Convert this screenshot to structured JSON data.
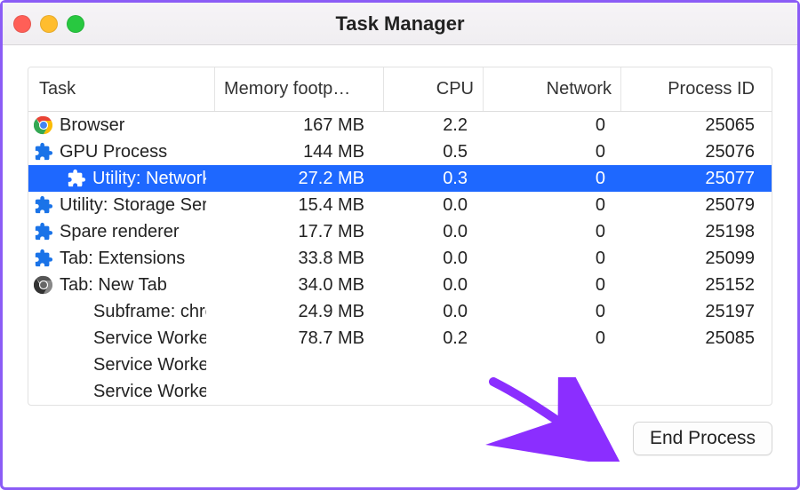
{
  "window": {
    "title": "Task Manager"
  },
  "columns": {
    "task": "Task",
    "memory": "Memory footp…",
    "cpu": "CPU",
    "network": "Network",
    "pid": "Process ID"
  },
  "rows": [
    {
      "icon": "chrome",
      "indent": false,
      "task": "Browser",
      "memory": "167 MB",
      "cpu": "2.2",
      "network": "0",
      "pid": "25065",
      "selected": false
    },
    {
      "icon": "ext",
      "indent": false,
      "task": "GPU Process",
      "memory": "144 MB",
      "cpu": "0.5",
      "network": "0",
      "pid": "25076",
      "selected": false
    },
    {
      "icon": "ext",
      "indent": true,
      "task": "Utility: Network Se",
      "memory": "27.2 MB",
      "cpu": "0.3",
      "network": "0",
      "pid": "25077",
      "selected": true
    },
    {
      "icon": "ext",
      "indent": false,
      "task": "Utility: Storage Ser",
      "memory": "15.4 MB",
      "cpu": "0.0",
      "network": "0",
      "pid": "25079",
      "selected": false
    },
    {
      "icon": "ext",
      "indent": false,
      "task": "Spare renderer",
      "memory": "17.7 MB",
      "cpu": "0.0",
      "network": "0",
      "pid": "25198",
      "selected": false
    },
    {
      "icon": "ext",
      "indent": false,
      "task": "Tab: Extensions",
      "memory": "33.8 MB",
      "cpu": "0.0",
      "network": "0",
      "pid": "25099",
      "selected": false
    },
    {
      "icon": "chrome-gray",
      "indent": false,
      "task": "Tab: New Tab",
      "memory": "34.0 MB",
      "cpu": "0.0",
      "network": "0",
      "pid": "25152",
      "selected": false
    },
    {
      "icon": "",
      "indent": true,
      "task": "Subframe: chrome",
      "memory": "24.9 MB",
      "cpu": "0.0",
      "network": "0",
      "pid": "25197",
      "selected": false
    },
    {
      "icon": "",
      "indent": true,
      "task": "Service Worker: htt",
      "memory": "78.7 MB",
      "cpu": "0.2",
      "network": "0",
      "pid": "25085",
      "selected": false
    },
    {
      "icon": "",
      "indent": true,
      "task": "Service Worker: htt",
      "memory": "",
      "cpu": "",
      "network": "",
      "pid": "",
      "selected": false
    },
    {
      "icon": "",
      "indent": true,
      "task": "Service Worker: htt",
      "memory": "",
      "cpu": "",
      "network": "",
      "pid": "",
      "selected": false
    }
  ],
  "footer": {
    "end_process": "End Process"
  }
}
